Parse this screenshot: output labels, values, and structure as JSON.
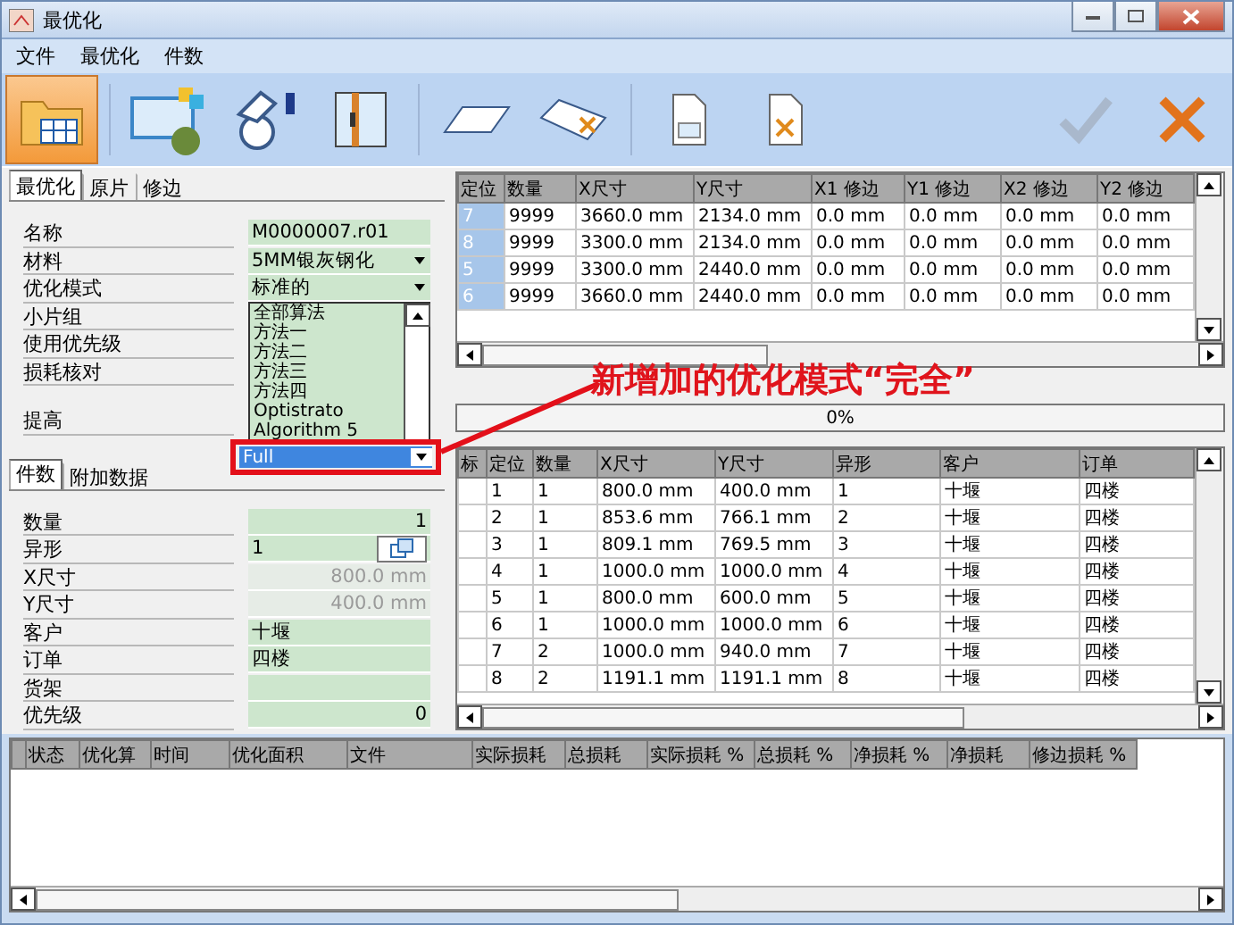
{
  "window": {
    "title": "最优化"
  },
  "menu": [
    "文件",
    "最优化",
    "件数"
  ],
  "toolbar": [
    {
      "kind": "open-folder",
      "selected": true
    },
    {
      "kind": "import",
      "selected": false
    },
    {
      "kind": "hand",
      "selected": false
    },
    {
      "kind": "panel",
      "selected": false
    },
    {
      "kind": "sheet",
      "selected": false
    },
    {
      "kind": "sheet-delete",
      "selected": false
    },
    {
      "kind": "file",
      "selected": false
    },
    {
      "kind": "file-delete",
      "selected": false
    }
  ],
  "actions": [
    {
      "kind": "confirm",
      "disabled": true
    },
    {
      "kind": "cancel",
      "disabled": false
    }
  ],
  "optimize_tabs": [
    {
      "label": "最优化",
      "selected": true
    },
    {
      "label": "原片",
      "selected": false
    },
    {
      "label": "修边",
      "selected": false
    }
  ],
  "optimize_form": [
    {
      "label": "名称",
      "kind": "text",
      "value": "M0000007.r01"
    },
    {
      "label": "材料",
      "kind": "select",
      "value": "5MM银灰钢化"
    },
    {
      "label": "优化模式",
      "kind": "select",
      "value": "标准的"
    },
    {
      "label": "小片组",
      "kind": "label"
    },
    {
      "label": "使用优先级",
      "kind": "label"
    },
    {
      "label": "损耗核对",
      "kind": "label"
    },
    {
      "label": "提高",
      "kind": "label",
      "gap": true
    }
  ],
  "mode_dropdown": {
    "options": [
      {
        "label": "全部算法",
        "selected": false
      },
      {
        "label": "方法一",
        "selected": false
      },
      {
        "label": "方法二",
        "selected": false
      },
      {
        "label": "方法三",
        "selected": false
      },
      {
        "label": "方法四",
        "selected": false
      },
      {
        "label": "Optistrato",
        "selected": false
      },
      {
        "label": "Algorithm 5",
        "selected": false
      }
    ],
    "current": "Full"
  },
  "annotation": {
    "text": "新增加的优化模式“完全”"
  },
  "piece_tabs": [
    {
      "label": "件数",
      "selected": true
    },
    {
      "label": "附加数据",
      "selected": false
    }
  ],
  "piece_form": [
    {
      "label": "数量",
      "kind": "number",
      "value": "1"
    },
    {
      "label": "异形",
      "kind": "picker",
      "value": "1"
    },
    {
      "label": "X尺寸",
      "kind": "readonly",
      "value": "800.0 mm"
    },
    {
      "label": "Y尺寸",
      "kind": "readonly",
      "value": "400.0 mm"
    },
    {
      "label": "客户",
      "kind": "text",
      "value": "十堰"
    },
    {
      "label": "订单",
      "kind": "text",
      "value": "四楼"
    },
    {
      "label": "货架",
      "kind": "text"
    },
    {
      "label": "优先级",
      "kind": "number",
      "value": "0"
    }
  ],
  "sheets_table": {
    "columns": [
      "定位",
      "数量",
      "X尺寸",
      "Y尺寸",
      "X1 修边",
      "Y1 修边",
      "X2 修边",
      "Y2 修边"
    ],
    "rows": [
      [
        "7",
        "9999",
        "3660.0 mm",
        "2134.0 mm",
        "0.0 mm",
        "0.0 mm",
        "0.0 mm",
        "0.0 mm"
      ],
      [
        "8",
        "9999",
        "3300.0 mm",
        "2134.0 mm",
        "0.0 mm",
        "0.0 mm",
        "0.0 mm",
        "0.0 mm"
      ],
      [
        "5",
        "9999",
        "3300.0 mm",
        "2440.0 mm",
        "0.0 mm",
        "0.0 mm",
        "0.0 mm",
        "0.0 mm"
      ],
      [
        "6",
        "9999",
        "3660.0 mm",
        "2440.0 mm",
        "0.0 mm",
        "0.0 mm",
        "0.0 mm",
        "0.0 mm"
      ]
    ]
  },
  "progress": {
    "text": "0%",
    "level": 0
  },
  "pieces_table": {
    "columns": [
      "标",
      "定位",
      "数量",
      "X尺寸",
      "Y尺寸",
      "异形",
      "客户",
      "订单"
    ],
    "rows": [
      [
        "",
        "1",
        "1",
        "800.0 mm",
        "400.0 mm",
        "1",
        "十堰",
        "四楼"
      ],
      [
        "",
        "2",
        "1",
        "853.6 mm",
        "766.1 mm",
        "2",
        "十堰",
        "四楼"
      ],
      [
        "",
        "3",
        "1",
        "809.1 mm",
        "769.5 mm",
        "3",
        "十堰",
        "四楼"
      ],
      [
        "",
        "4",
        "1",
        "1000.0 mm",
        "1000.0 mm",
        "4",
        "十堰",
        "四楼"
      ],
      [
        "",
        "5",
        "1",
        "800.0 mm",
        "600.0 mm",
        "5",
        "十堰",
        "四楼"
      ],
      [
        "",
        "6",
        "1",
        "1000.0 mm",
        "1000.0 mm",
        "6",
        "十堰",
        "四楼"
      ],
      [
        "",
        "7",
        "2",
        "1000.0 mm",
        "940.0 mm",
        "7",
        "十堰",
        "四楼"
      ],
      [
        "",
        "8",
        "2",
        "1191.1 mm",
        "1191.1 mm",
        "8",
        "十堰",
        "四楼"
      ]
    ]
  },
  "results_table": {
    "columns": [
      "状态",
      "优化算",
      "时间",
      "优化面积",
      "文件",
      "实际损耗",
      "总损耗",
      "实际损耗 %",
      "总损耗 %",
      "净损耗 %",
      "净损耗",
      "修边损耗 %"
    ]
  }
}
